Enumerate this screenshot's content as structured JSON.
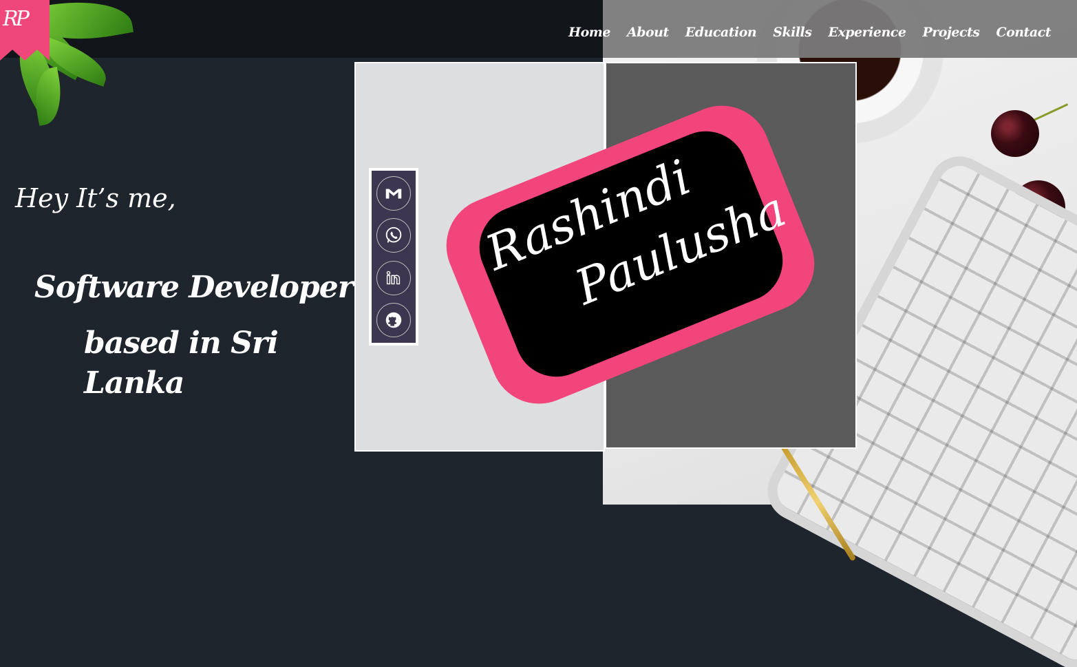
{
  "logo": {
    "text": "RP"
  },
  "nav": {
    "items": [
      {
        "label": "Home"
      },
      {
        "label": "About"
      },
      {
        "label": "Education"
      },
      {
        "label": "Skills"
      },
      {
        "label": "Experience"
      },
      {
        "label": "Projects"
      },
      {
        "label": "Contact"
      }
    ]
  },
  "hero": {
    "greeting": "Hey It’s me,",
    "role": "Software Developer",
    "location": "based in Sri Lanka"
  },
  "card": {
    "first_name": "Rashindi",
    "last_name": "Paulusha"
  },
  "social": [
    {
      "icon": "gmail-icon"
    },
    {
      "icon": "whatsapp-icon"
    },
    {
      "icon": "linkedin-icon"
    },
    {
      "icon": "github-icon"
    }
  ],
  "colors": {
    "accent": "#f0477a",
    "dark_bg": "#1f252d",
    "topbar": "#12161b",
    "social_bg": "#3c3650"
  }
}
